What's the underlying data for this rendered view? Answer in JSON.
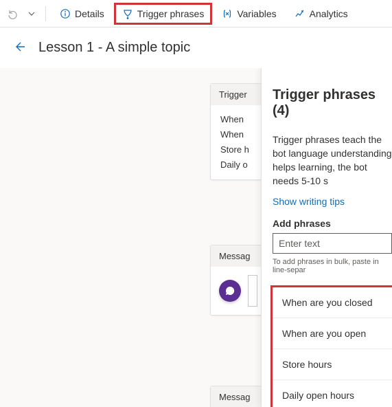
{
  "toolbar": {
    "details": "Details",
    "trigger": "Trigger phrases",
    "variables": "Variables",
    "analytics": "Analytics"
  },
  "titlebar": {
    "title": "Lesson 1 - A simple topic"
  },
  "canvas": {
    "trigger_card_header": "Trigger",
    "trigger_lines": [
      "When",
      "When",
      "Store h",
      "Daily o"
    ],
    "message_header": "Messag"
  },
  "panel": {
    "title": "Trigger phrases (4)",
    "desc": "Trigger phrases teach the bot language understanding helps learning, the bot needs 5-10 s",
    "show_tips": "Show writing tips",
    "add_label": "Add phrases",
    "add_placeholder": "Enter text",
    "hint": "To add phrases in bulk, paste in line-separ",
    "phrases": [
      "When are you closed",
      "When are you open",
      "Store hours",
      "Daily open hours"
    ]
  }
}
